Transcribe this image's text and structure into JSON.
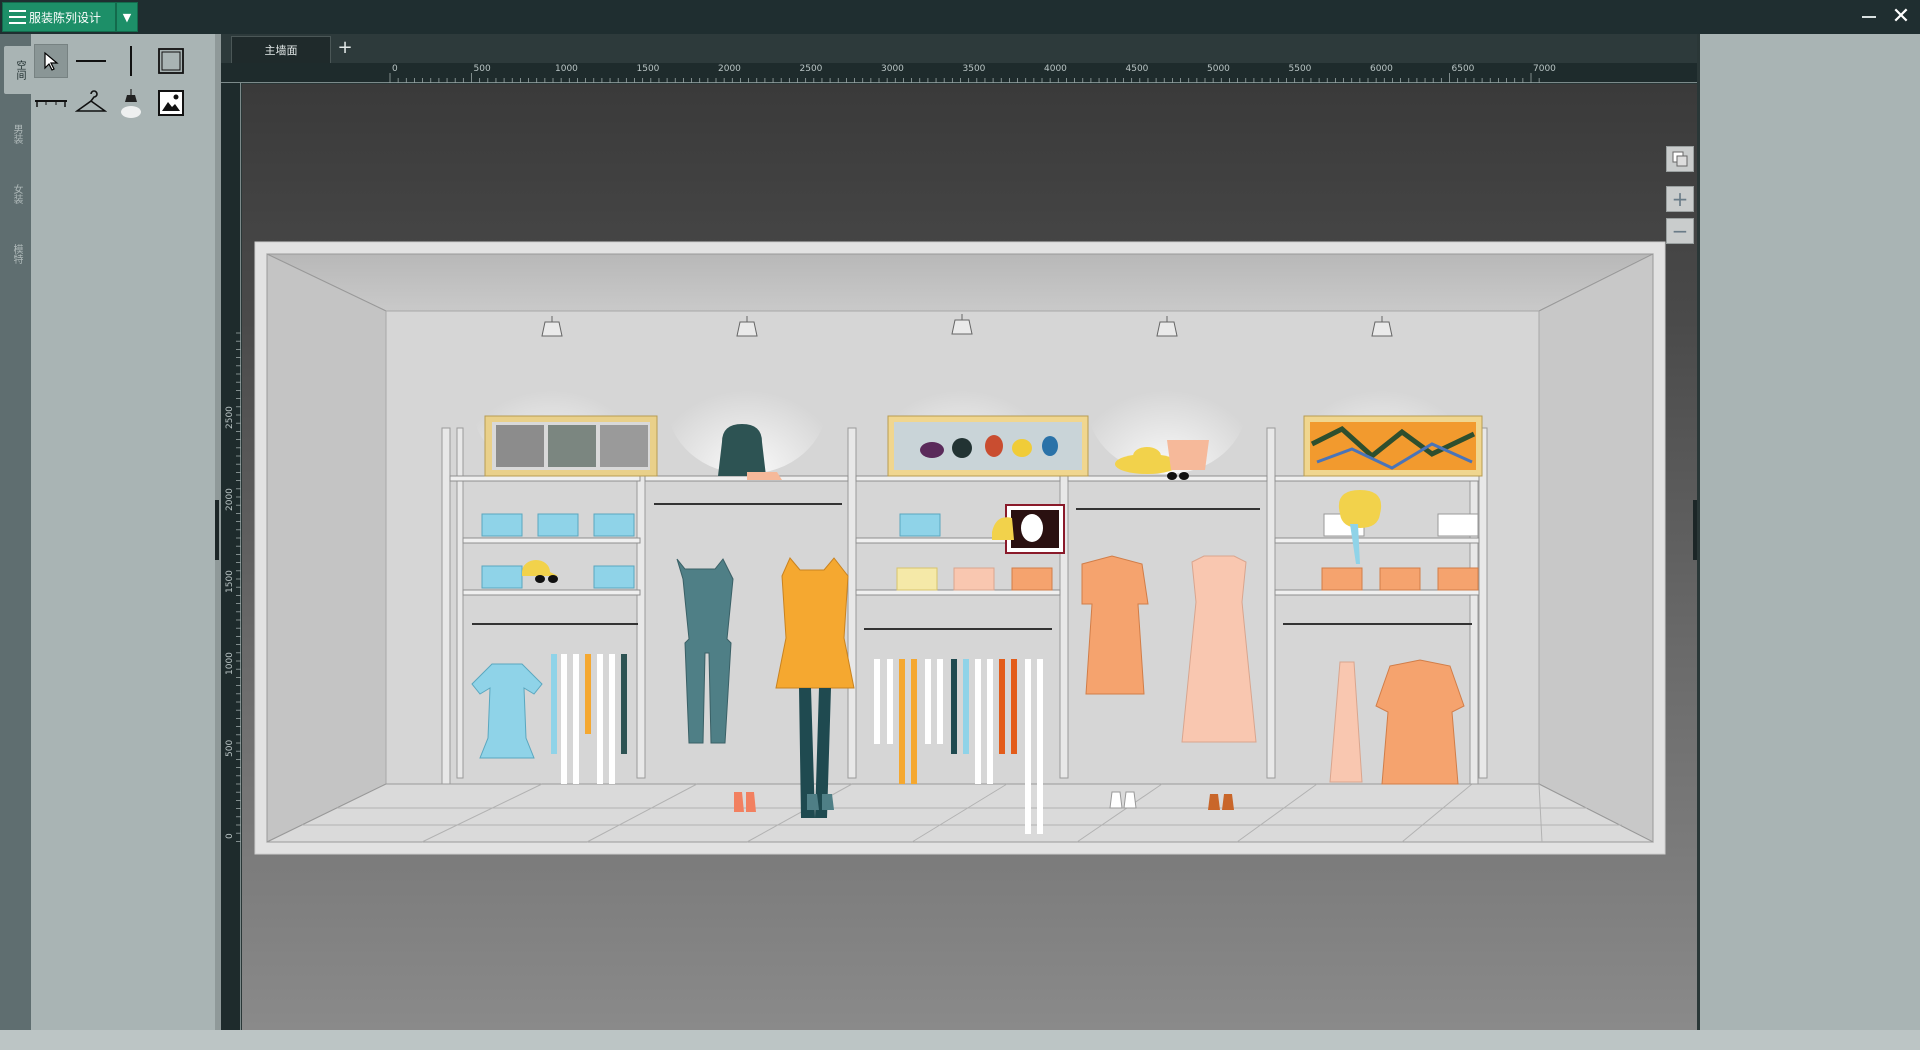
{
  "app": {
    "title": "服装陈列设计"
  },
  "window": {
    "close_glyph": "✕"
  },
  "left_tabs": [
    {
      "label": "空间",
      "active": true
    },
    {
      "label": "男装",
      "active": false
    },
    {
      "label": "女装",
      "active": false
    },
    {
      "label": "模特",
      "active": false
    }
  ],
  "tools": [
    {
      "name": "select-tool",
      "icon": "cursor-icon",
      "active": true
    },
    {
      "name": "horizontal-line-tool",
      "icon": "horizontal-line-icon",
      "active": false
    },
    {
      "name": "vertical-line-tool",
      "icon": "vertical-line-icon",
      "active": false
    },
    {
      "name": "rectangle-tool",
      "icon": "rectangle-icon",
      "active": false
    },
    {
      "name": "rail-tool",
      "icon": "rail-icon",
      "active": false
    },
    {
      "name": "hanger-tool",
      "icon": "hanger-icon",
      "active": false
    },
    {
      "name": "spotlight-tool",
      "icon": "spotlight-icon",
      "active": false
    },
    {
      "name": "image-tool",
      "icon": "image-icon",
      "active": false
    }
  ],
  "tabs": [
    {
      "label": "主墙面",
      "active": true
    }
  ],
  "tab_add_label": "+",
  "ruler_h": [
    "0",
    "500",
    "1000",
    "1500",
    "2000",
    "2500",
    "3000",
    "3500",
    "4000",
    "4500",
    "5000",
    "5500",
    "6000",
    "6500",
    "7000"
  ],
  "ruler_v": [
    "2500",
    "2000",
    "1500",
    "1000",
    "500",
    "0"
  ],
  "zoom": {
    "copy_icon": "copy-icon",
    "zoom_in": "+",
    "zoom_out": "−"
  },
  "colors": {
    "accent": "#1d8f68",
    "titlebar": "#1f2e30",
    "panel": "#a9b4b4",
    "orange": "#f5a36e",
    "peach": "#f9c7b0",
    "teal": "#4f7f86",
    "cyan": "#8fd3e8",
    "yellow": "#f2d24b",
    "gold": "#efc14a"
  }
}
